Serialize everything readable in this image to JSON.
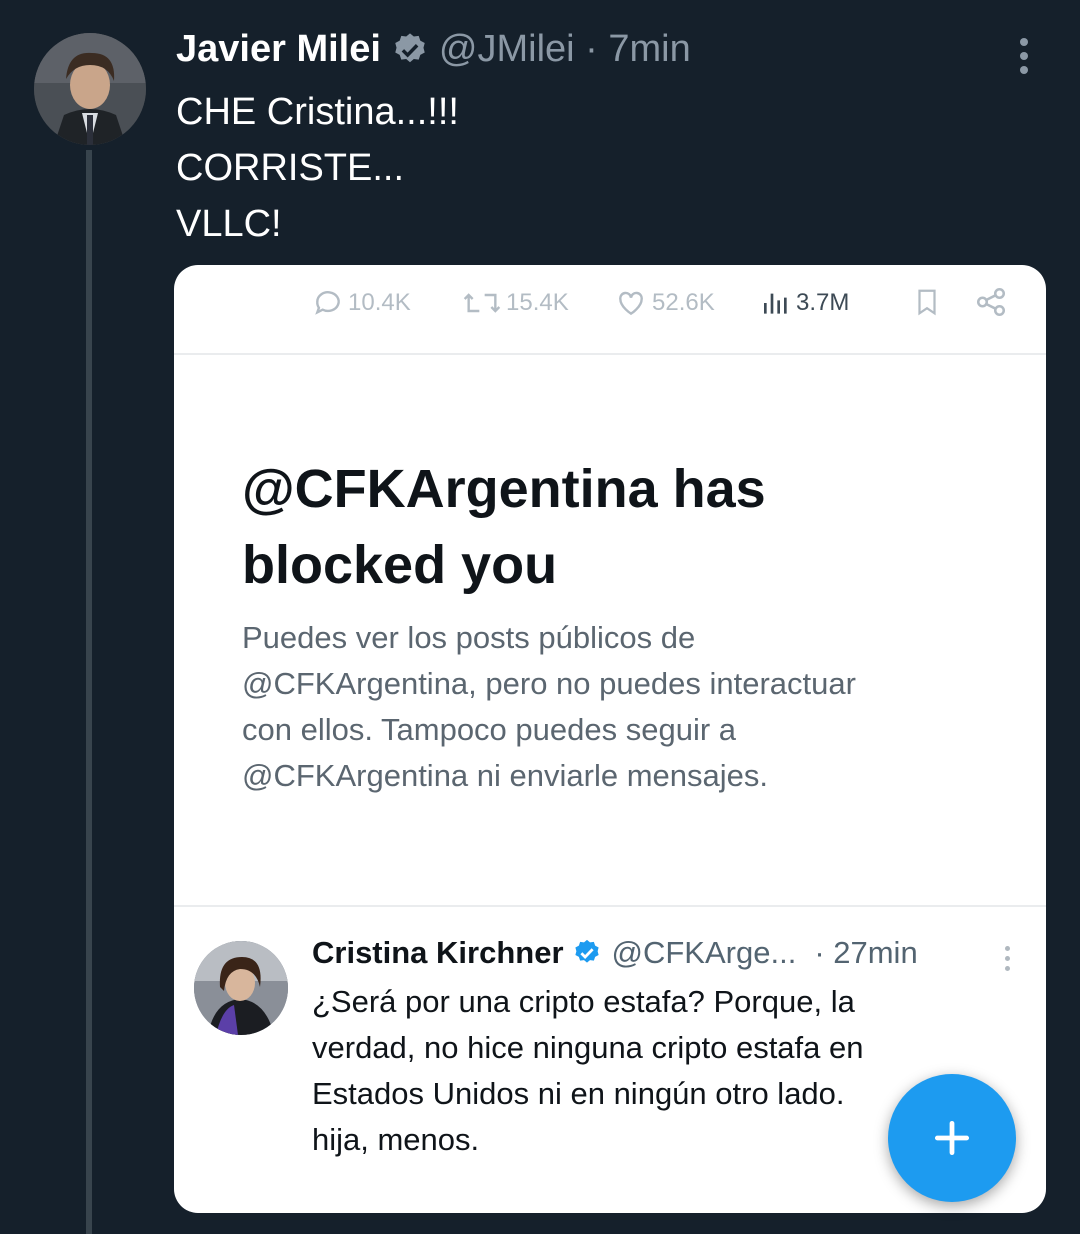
{
  "post": {
    "author_name": "Javier Milei",
    "handle_time": "@JMilei · 7min",
    "text_lines": [
      "CHE Cristina...!!!",
      "CORRISTE...",
      "VLLC!"
    ]
  },
  "embedded": {
    "stats": {
      "replies": "10.4K",
      "reposts": "15.4K",
      "likes": "52.6K",
      "views": "3.7M"
    },
    "blocked_title_lines": [
      "@CFKArgentina has",
      "blocked you"
    ],
    "blocked_body_lines": [
      "Puedes ver los posts públicos de",
      "@CFKArgentina, pero no puedes interactuar",
      "con ellos. Tampoco puedes seguir a",
      "@CFKArgentina ni enviarle mensajes."
    ],
    "quoted": {
      "name": "Cristina Kirchner",
      "handle": "@CFKArge...",
      "time": "· 27min",
      "text_lines": [
        "¿Será por una cripto estafa? Porque, la",
        "verdad, no hice ninguna cripto estafa en",
        "Estados Unidos ni en ningún otro lado.",
        "hija, menos."
      ]
    }
  },
  "colors": {
    "background": "#15202b",
    "accent": "#1d9bf0",
    "text_primary": "#ffffff",
    "text_secondary": "#8b98a5"
  },
  "icons": [
    "verified-badge-icon",
    "more-icon",
    "reply-icon",
    "repost-icon",
    "like-icon",
    "views-icon",
    "bookmark-icon",
    "share-icon",
    "compose-plus-icon"
  ]
}
